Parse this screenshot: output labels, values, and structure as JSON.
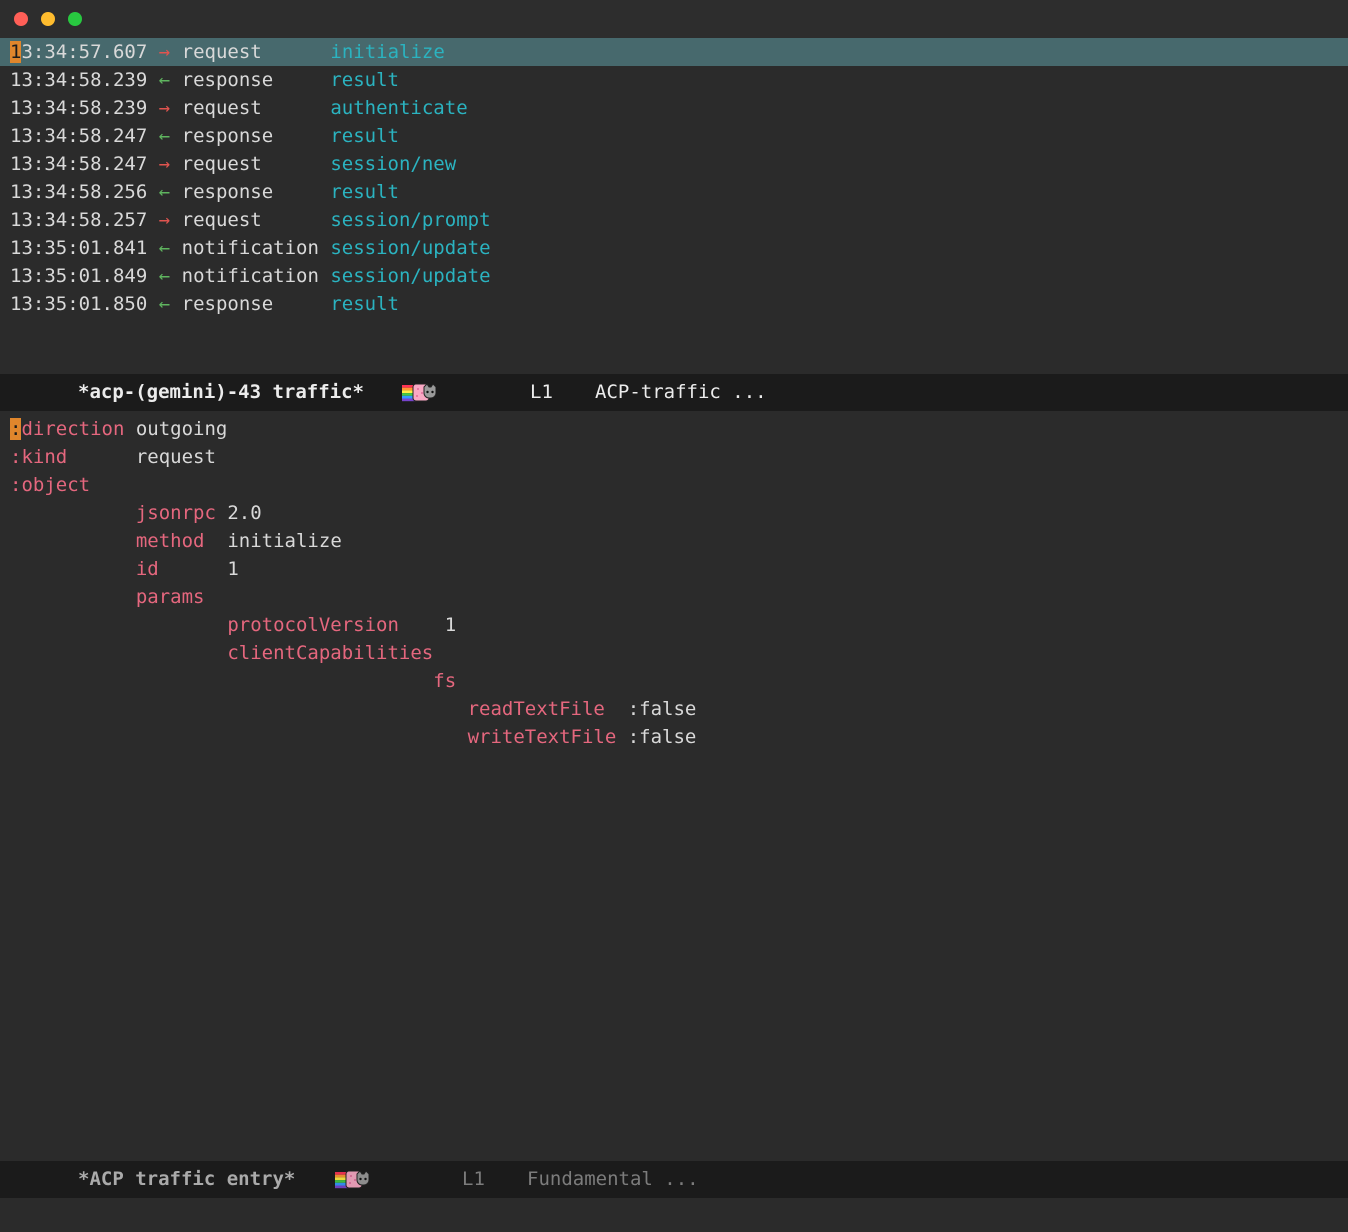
{
  "colors": {
    "background": "#2b2b2b",
    "modeline_bg": "#1b1b1b",
    "text": "#d9d9d9",
    "selected_row_bg": "#47696d",
    "cursor_orange": "#e0862c",
    "method_cyan": "#2bb3c0",
    "key_pink": "#e5677e",
    "outgoing_red": "#e0544f",
    "incoming_green": "#5fb55f"
  },
  "titlebar": {
    "buttons": [
      "close",
      "minimize",
      "zoom"
    ]
  },
  "traffic_log": {
    "rows": [
      {
        "time": "13:34:57.607",
        "direction": "outgoing",
        "arrow": "→",
        "kind": "request",
        "method": "initialize",
        "selected": true,
        "cursor": true
      },
      {
        "time": "13:34:58.239",
        "direction": "incoming",
        "arrow": "←",
        "kind": "response",
        "method": "result"
      },
      {
        "time": "13:34:58.239",
        "direction": "outgoing",
        "arrow": "→",
        "kind": "request",
        "method": "authenticate"
      },
      {
        "time": "13:34:58.247",
        "direction": "incoming",
        "arrow": "←",
        "kind": "response",
        "method": "result"
      },
      {
        "time": "13:34:58.247",
        "direction": "outgoing",
        "arrow": "→",
        "kind": "request",
        "method": "session/new"
      },
      {
        "time": "13:34:58.256",
        "direction": "incoming",
        "arrow": "←",
        "kind": "response",
        "method": "result"
      },
      {
        "time": "13:34:58.257",
        "direction": "outgoing",
        "arrow": "→",
        "kind": "request",
        "method": "session/prompt"
      },
      {
        "time": "13:35:01.841",
        "direction": "incoming",
        "arrow": "←",
        "kind": "notification",
        "method": "session/update"
      },
      {
        "time": "13:35:01.849",
        "direction": "incoming",
        "arrow": "←",
        "kind": "notification",
        "method": "session/update"
      },
      {
        "time": "13:35:01.850",
        "direction": "incoming",
        "arrow": "←",
        "kind": "response",
        "method": "result"
      }
    ]
  },
  "modeline_top": {
    "buffer_name": "*acp-(gemini)-43 traffic*",
    "line_indicator": "L1",
    "mode": "ACP-traffic ..."
  },
  "entry_detail": {
    "lines": [
      [
        [
          "cur",
          ":"
        ],
        [
          "k",
          "direction"
        ],
        [
          "v",
          " outgoing"
        ]
      ],
      [
        [
          "k",
          ":kind"
        ],
        [
          "v",
          "      request"
        ]
      ],
      [
        [
          "k",
          ":object"
        ]
      ],
      [
        [
          "v",
          "           "
        ],
        [
          "k",
          "jsonrpc"
        ],
        [
          "v",
          " 2.0"
        ]
      ],
      [
        [
          "v",
          "           "
        ],
        [
          "k",
          "method"
        ],
        [
          "v",
          "  initialize"
        ]
      ],
      [
        [
          "v",
          "           "
        ],
        [
          "k",
          "id"
        ],
        [
          "v",
          "      1"
        ]
      ],
      [
        [
          "v",
          "           "
        ],
        [
          "k",
          "params"
        ]
      ],
      [
        [
          "v",
          "                   "
        ],
        [
          "k",
          "protocolVersion"
        ],
        [
          "v",
          "    1"
        ]
      ],
      [
        [
          "v",
          "                   "
        ],
        [
          "k",
          "clientCapabilities"
        ]
      ],
      [
        [
          "v",
          "                                     "
        ],
        [
          "k",
          "fs"
        ]
      ],
      [
        [
          "v",
          "                                        "
        ],
        [
          "k",
          "readTextFile"
        ],
        [
          "v",
          "  :false"
        ]
      ],
      [
        [
          "v",
          "                                        "
        ],
        [
          "k",
          "writeTextFile"
        ],
        [
          "v",
          " :false"
        ]
      ]
    ]
  },
  "modeline_bottom": {
    "buffer_name": "*ACP traffic entry*",
    "line_indicator": "L1",
    "mode": "Fundamental ..."
  }
}
